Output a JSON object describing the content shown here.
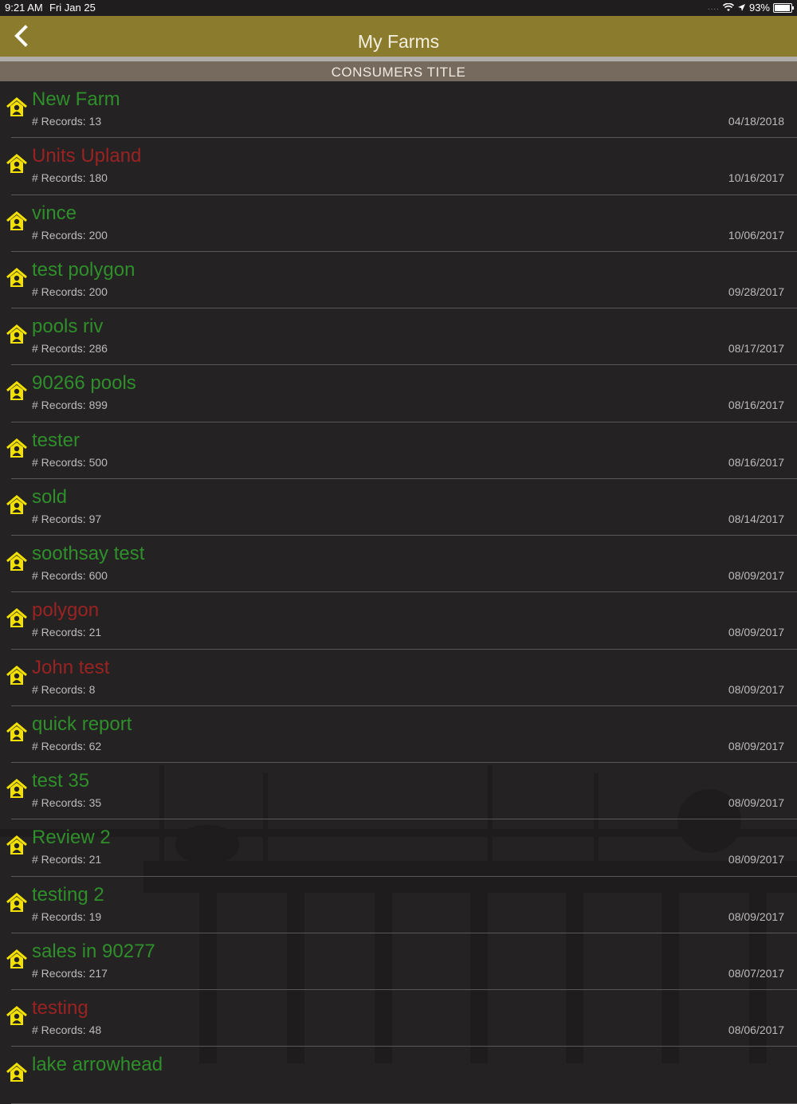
{
  "status_bar": {
    "time": "9:21 AM",
    "date": "Fri Jan 25",
    "signal_dots": "....",
    "battery": "93%",
    "battery_level": 0.93
  },
  "nav": {
    "title": "My Farms",
    "back_icon": "chevron-left-icon"
  },
  "section_header": "CONSUMERS TITLE",
  "colors": {
    "nav_bar": "#8b7b2d",
    "header_bar": "#766a5e",
    "active_name": "#2f8f2a",
    "inactive_name": "#9b2222",
    "icon_yellow": "#f2e000"
  },
  "farms": [
    {
      "name": "New Farm",
      "records": "# Records: 13",
      "date": "04/18/2018",
      "status": "green"
    },
    {
      "name": "Units Upland",
      "records": "# Records: 180",
      "date": "10/16/2017",
      "status": "red"
    },
    {
      "name": "vince",
      "records": "# Records: 200",
      "date": "10/06/2017",
      "status": "green"
    },
    {
      "name": "test polygon",
      "records": "# Records: 200",
      "date": "09/28/2017",
      "status": "green"
    },
    {
      "name": "pools riv",
      "records": "# Records: 286",
      "date": "08/17/2017",
      "status": "green"
    },
    {
      "name": "90266 pools",
      "records": "# Records: 899",
      "date": "08/16/2017",
      "status": "green"
    },
    {
      "name": "tester",
      "records": "# Records: 500",
      "date": "08/16/2017",
      "status": "green"
    },
    {
      "name": "sold",
      "records": "# Records: 97",
      "date": "08/14/2017",
      "status": "green"
    },
    {
      "name": "soothsay test",
      "records": "# Records: 600",
      "date": "08/09/2017",
      "status": "green"
    },
    {
      "name": "polygon",
      "records": "# Records: 21",
      "date": "08/09/2017",
      "status": "red"
    },
    {
      "name": "John test",
      "records": "# Records: 8",
      "date": "08/09/2017",
      "status": "red"
    },
    {
      "name": "quick report",
      "records": "# Records: 62",
      "date": "08/09/2017",
      "status": "green"
    },
    {
      "name": "test 35",
      "records": "# Records: 35",
      "date": "08/09/2017",
      "status": "green"
    },
    {
      "name": "Review 2",
      "records": "# Records: 21",
      "date": "08/09/2017",
      "status": "green"
    },
    {
      "name": "testing 2",
      "records": "# Records: 19",
      "date": "08/09/2017",
      "status": "green"
    },
    {
      "name": "sales in 90277",
      "records": "# Records: 217",
      "date": "08/07/2017",
      "status": "green"
    },
    {
      "name": "testing",
      "records": "# Records: 48",
      "date": "08/06/2017",
      "status": "red"
    },
    {
      "name": "lake arrowhead",
      "records": "",
      "date": "",
      "status": "green"
    }
  ]
}
